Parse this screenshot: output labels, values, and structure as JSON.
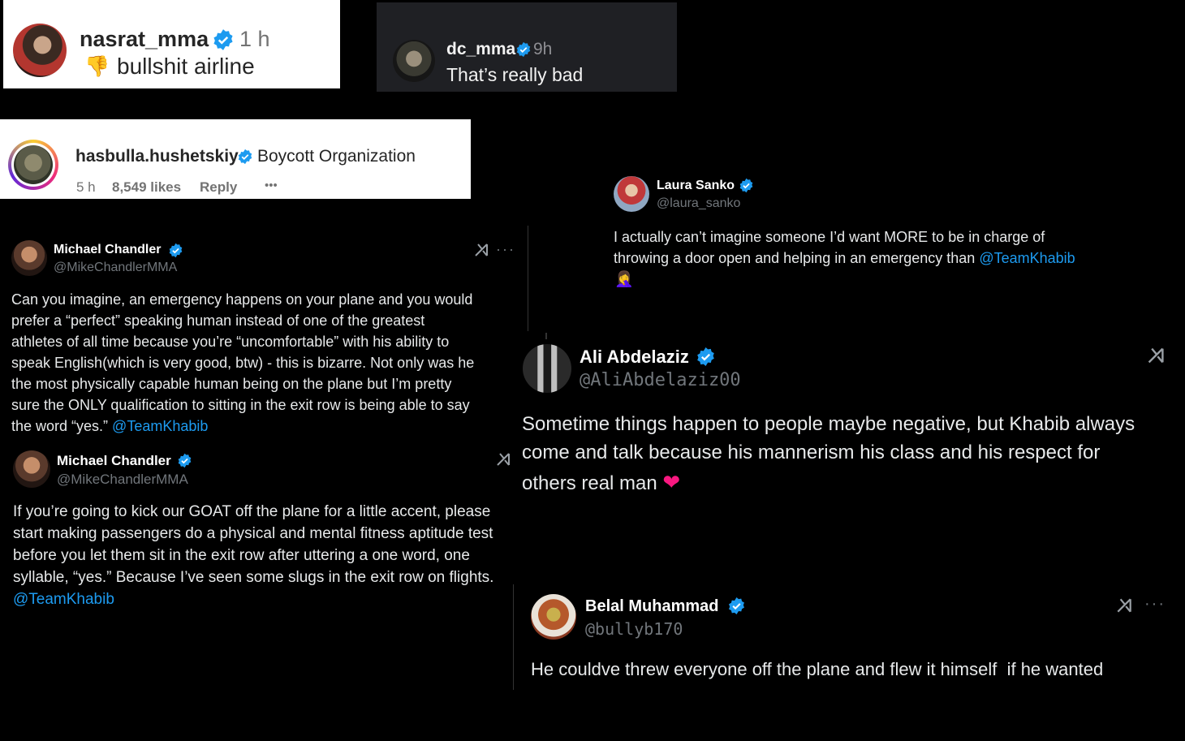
{
  "cards": {
    "nasrat": {
      "username": "nasrat_mma",
      "time": "1 h",
      "emoji": "👎",
      "comment": "bullshit airline",
      "avatar_icon": "profile-photo"
    },
    "dc": {
      "username": "dc_mma",
      "time": "9h",
      "comment": "That’s really bad",
      "avatar_icon": "profile-photo"
    },
    "hasbulla": {
      "username": "hasbulla.hushetskiy",
      "comment": "Boycott Organization",
      "time": "5 h",
      "likes": "8,549 likes",
      "reply": "Reply",
      "more": "•••",
      "avatar_icon": "profile-photo"
    },
    "laura": {
      "name": "Laura Sanko",
      "handle": "@laura_sanko",
      "text1": "I actually can’t imagine someone I’d want MORE to be in charge of",
      "text2": "throwing a door open and helping in an emergency than ",
      "mention": "@TeamKhabib",
      "emoji": "🤦‍♀️"
    },
    "chandler1": {
      "name": "Michael Chandler",
      "handle": "@MikeChandlerMMA",
      "lines": [
        "Can you imagine, an emergency happens on your plane and you would",
        "prefer a “perfect” speaking human instead of one of the greatest",
        "athletes of all time because you’re “uncomfortable” with his ability to",
        "speak English(which is very good, btw) - this is bizarre. Not only was he",
        "the most physically capable human being on the plane but I’m pretty",
        "sure the ONLY qualification to sitting in the exit row is being able to say",
        "the word “yes.” "
      ],
      "mention": "@TeamKhabib",
      "more": "···"
    },
    "chandler2": {
      "name": "Michael Chandler",
      "handle": "@MikeChandlerMMA",
      "lines": [
        "If you’re going to kick our GOAT off the plane for a little accent, please",
        "start making passengers do a physical and mental fitness aptitude test",
        "before you let them sit in the exit row after uttering a one word, one",
        "syllable, “yes.” Because I’ve seen some slugs in the exit row on flights."
      ],
      "mention": "@TeamKhabib"
    },
    "ali": {
      "name": "Ali Abdelaziz",
      "handle": "@AliAbdelaziz00",
      "lines": [
        "Sometime things happen to people maybe negative, but Khabib always",
        "come and talk because his mannerism his class and his respect for",
        "others real man "
      ],
      "emoji": "❤"
    },
    "belal": {
      "name": "Belal Muhammad",
      "handle": "@bullyb170",
      "text": "He couldve threw everyone off the plane and flew it himself  if he wanted",
      "more": "···"
    }
  },
  "colors": {
    "background": "#000000",
    "mention": "#1d9bf0",
    "verified": "#1d9bf0",
    "handle": "#71767b",
    "heart": "#f91880"
  }
}
